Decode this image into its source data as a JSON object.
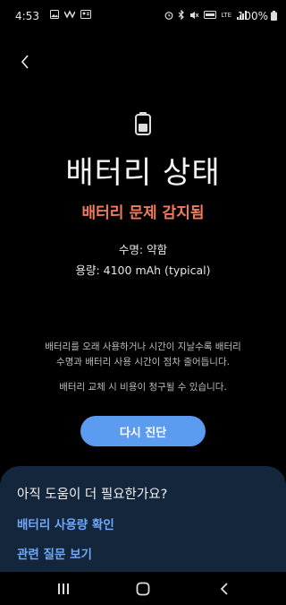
{
  "status_bar": {
    "time": "4:53",
    "battery_percent": "100%",
    "network": "LTE"
  },
  "header": {
    "back_label": "Back"
  },
  "main": {
    "title": "배터리 상태",
    "problem_text": "배터리 문제 감지됨",
    "lifespan": "수명: 약함",
    "capacity": "용량: 4100 mAh (typical)",
    "description_line1": "배터리를 오래 사용하거나 시간이 지날수록 배터리",
    "description_line2": "수명과 배터리 사용 시간이 점차 줄어듭니다.",
    "cost_notice": "배터리 교체 시 비용이 청구될 수 있습니다.",
    "rediagnose_label": "다시 진단"
  },
  "help_card": {
    "title": "아직 도움이 더 필요한가요?",
    "links": [
      "배터리 사용량 확인",
      "관련 질문 보기"
    ]
  },
  "colors": {
    "background": "#000000",
    "problem": "#f07a5e",
    "button": "#5b9bf0",
    "card": "#13263c",
    "link": "#6fa8f7"
  },
  "icons": [
    "back-arrow-icon",
    "battery-icon",
    "recents-icon",
    "home-icon",
    "nav-back-icon"
  ]
}
